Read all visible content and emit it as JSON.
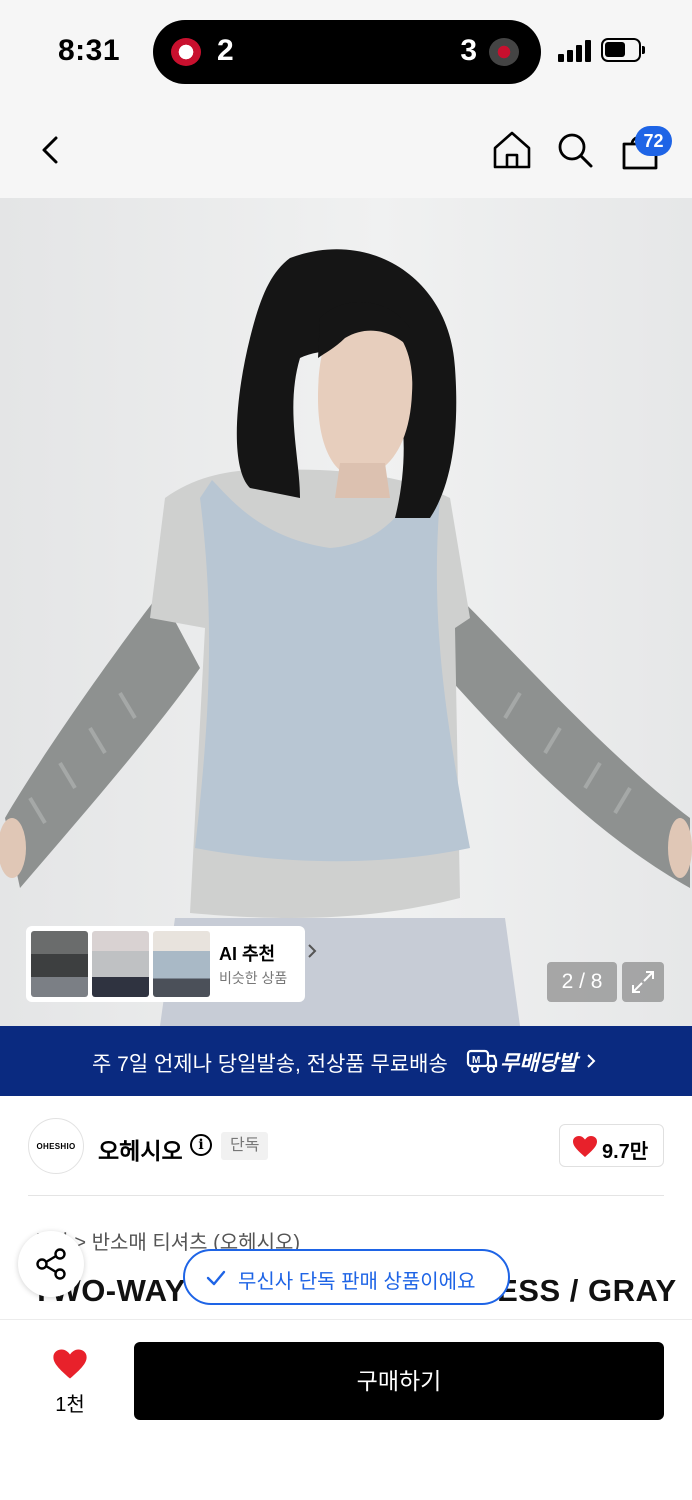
{
  "status_bar": {
    "time": "8:31",
    "score_left": "2",
    "score_right": "3"
  },
  "nav": {
    "cart_count": "72"
  },
  "hero": {
    "ai_title": "AI 추천",
    "ai_subtitle": "비슷한 상품",
    "page_counter": "2 / 8"
  },
  "banner": {
    "text": "주 7일 언제나 당일발송, 전상품 무료배송",
    "brand": "무배당발"
  },
  "brand": {
    "logo_text": "OHESHIO",
    "name": "오헤시오",
    "badge": "단독",
    "like_count": "9.7만"
  },
  "product": {
    "breadcrumb": "상의 > 반소매 티셔츠 (오헤시오)",
    "title": "TWO-WAY LAYERED SLEEVELESS / GRAY"
  },
  "toast": {
    "text": "무신사 단독 판매 상품이에요"
  },
  "bottom": {
    "like_count": "1천",
    "buy_label": "구매하기"
  },
  "colors": {
    "accent": "#1e64e6",
    "banner": "#0a2a80",
    "heart": "#e8212b"
  }
}
